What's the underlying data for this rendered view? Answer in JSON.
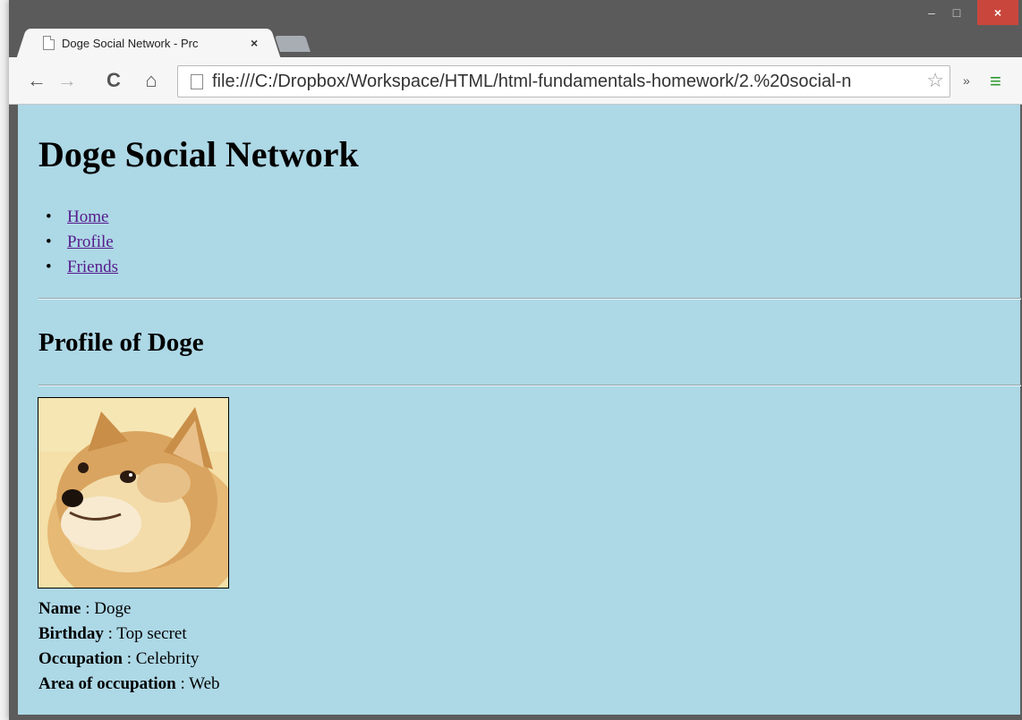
{
  "window": {
    "tab_title": "Doge Social Network - Prc",
    "tab_close": "×",
    "controls": {
      "minimize": "–",
      "maximize": "□",
      "close": "×"
    }
  },
  "toolbar": {
    "url": "file:///C:/Dropbox/Workspace/HTML/html-fundamentals-homework/2.%20social-n",
    "icons": {
      "back": "back-arrow-icon",
      "forward": "forward-arrow-icon",
      "reload": "reload-icon",
      "home": "home-icon",
      "bookmark": "star-icon",
      "extensions": "chevron-double-right-icon",
      "menu": "hamburger-menu-icon"
    }
  },
  "page": {
    "title": "Doge Social Network",
    "nav": [
      {
        "label": "Home"
      },
      {
        "label": "Profile"
      },
      {
        "label": "Friends"
      }
    ],
    "section_title": "Profile of Doge",
    "details": [
      {
        "label": "Name",
        "value": " : Doge"
      },
      {
        "label": "Birthday",
        "value": " : Top secret"
      },
      {
        "label": "Occupation",
        "value": " : Celebrity"
      },
      {
        "label": "Area of occupation",
        "value": " : Web"
      }
    ],
    "colors": {
      "page_bg": "#add8e6",
      "link": "#551a8b"
    }
  }
}
